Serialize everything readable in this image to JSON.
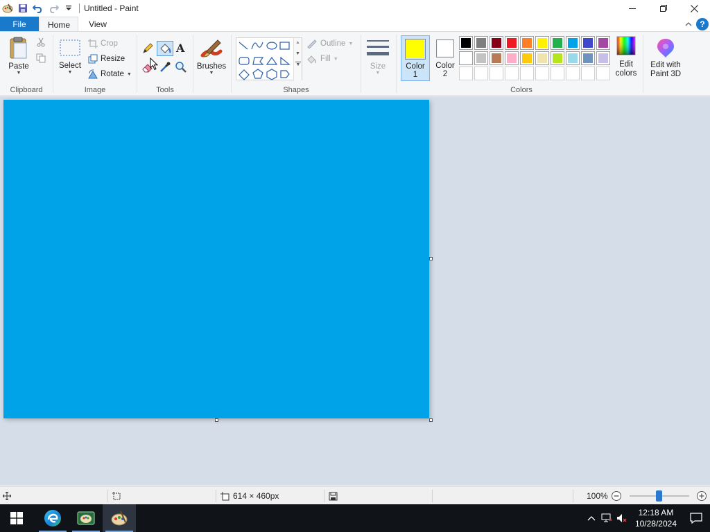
{
  "window": {
    "title": "Untitled - Paint"
  },
  "tabs": {
    "file": "File",
    "home": "Home",
    "view": "View"
  },
  "ribbon": {
    "clipboard": {
      "label": "Clipboard",
      "paste": "Paste"
    },
    "image": {
      "label": "Image",
      "select": "Select",
      "crop": "Crop",
      "resize": "Resize",
      "rotate": "Rotate"
    },
    "tools": {
      "label": "Tools"
    },
    "brushes": {
      "label": "Brushes"
    },
    "shapes": {
      "label": "Shapes",
      "outline": "Outline",
      "fill": "Fill"
    },
    "size": {
      "label": "Size"
    },
    "colors": {
      "label": "Colors",
      "color1_label": "Color",
      "color1_num": "1",
      "color2_label": "Color",
      "color2_num": "2",
      "color1_value": "#ffff00",
      "color2_value": "#ffffff",
      "edit_colors_line1": "Edit",
      "edit_colors_line2": "colors",
      "palette_row1": [
        "#000000",
        "#7f7f7f",
        "#880015",
        "#ed1c24",
        "#ff7f27",
        "#fff200",
        "#22b14c",
        "#00a2e8",
        "#3f48cc",
        "#a349a4"
      ],
      "palette_row2": [
        "#ffffff",
        "#c3c3c3",
        "#b97a57",
        "#ffaec9",
        "#ffc90e",
        "#efe4b0",
        "#b5e61d",
        "#99d9ea",
        "#7092be",
        "#c8bfe7"
      ],
      "palette_row3_count_empty": 10
    },
    "paint3d": {
      "line1": "Edit with",
      "line2": "Paint 3D"
    }
  },
  "canvas": {
    "fill_color": "#00a2e8"
  },
  "status": {
    "dimensions": "614 × 460px",
    "zoom": "100%"
  },
  "taskbar": {
    "time": "12:18 AM",
    "date": "10/28/2024"
  },
  "colors": {
    "accent": "#1979ca",
    "workspace": "#d4dde8"
  }
}
